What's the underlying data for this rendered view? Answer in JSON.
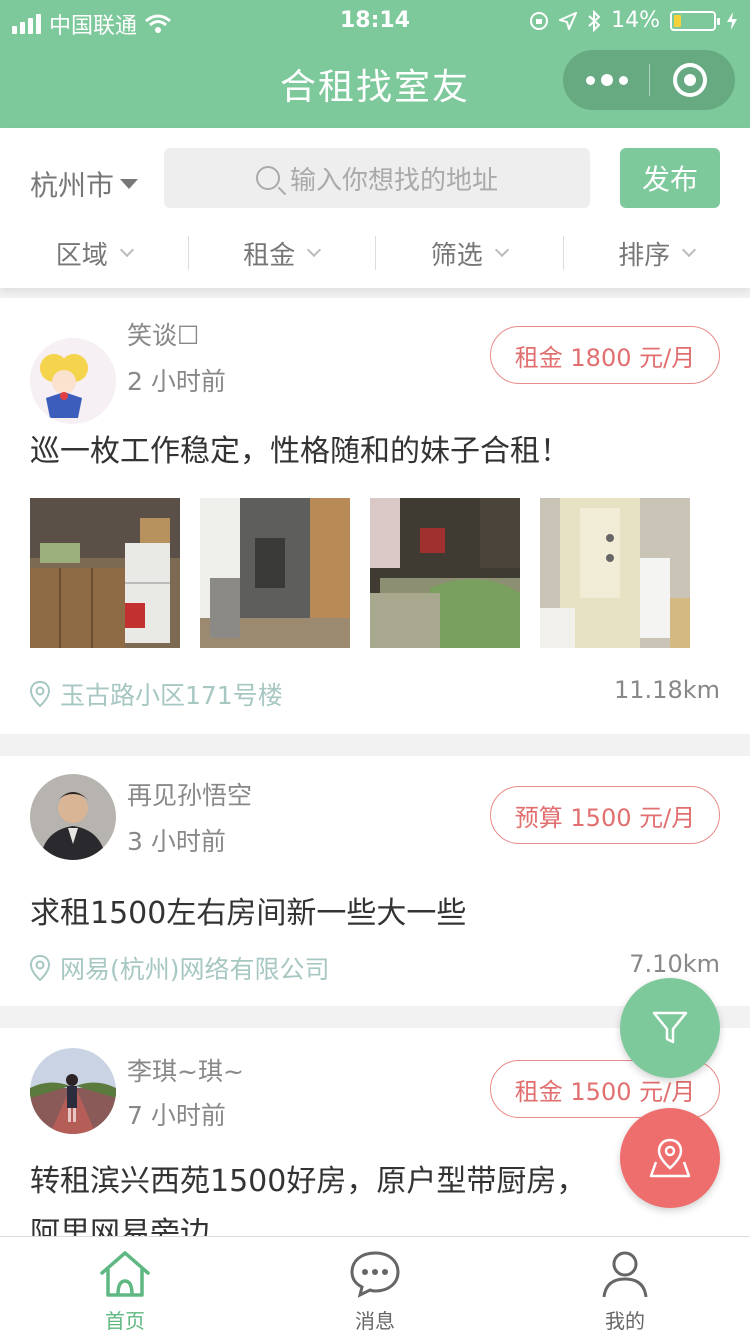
{
  "status_bar": {
    "carrier": "中国联通",
    "time": "18:14",
    "battery": "14%"
  },
  "nav": {
    "title": "合租找室友"
  },
  "search": {
    "city": "杭州市",
    "placeholder": "输入你想找的地址",
    "publish_label": "发布"
  },
  "filters": [
    "区域",
    "租金",
    "筛选",
    "排序"
  ],
  "posts": [
    {
      "username": "笑谈☐",
      "time": "2 小时前",
      "price": "租金 1800 元/月",
      "title": "巡一枚工作稳定，性格随和的妹子合租！",
      "location": "玉古路小区171号楼",
      "distance": "11.18km"
    },
    {
      "username": "再见孙悟空",
      "time": "3 小时前",
      "price": "预算 1500 元/月",
      "title": "求租1500左右房间新一些大一些",
      "location": "网易(杭州)网络有限公司",
      "distance": "7.10km"
    },
    {
      "username": "李琪~琪~",
      "time": "7 小时前",
      "price": "租金 1500 元/月",
      "title_line1": "转租滨兴西苑1500好房，原户型带厨房，",
      "title_line2": "阿里网易旁边"
    }
  ],
  "tabs": [
    {
      "label": "首页",
      "icon": "home-icon",
      "active": true
    },
    {
      "label": "消息",
      "icon": "chat-icon",
      "active": false
    },
    {
      "label": "我的",
      "icon": "user-icon",
      "active": false
    }
  ],
  "colors": {
    "brand": "#7ec99b",
    "price": "#e26f6f",
    "location": "#a7c7c3",
    "fab_red": "#ee6e6e"
  }
}
